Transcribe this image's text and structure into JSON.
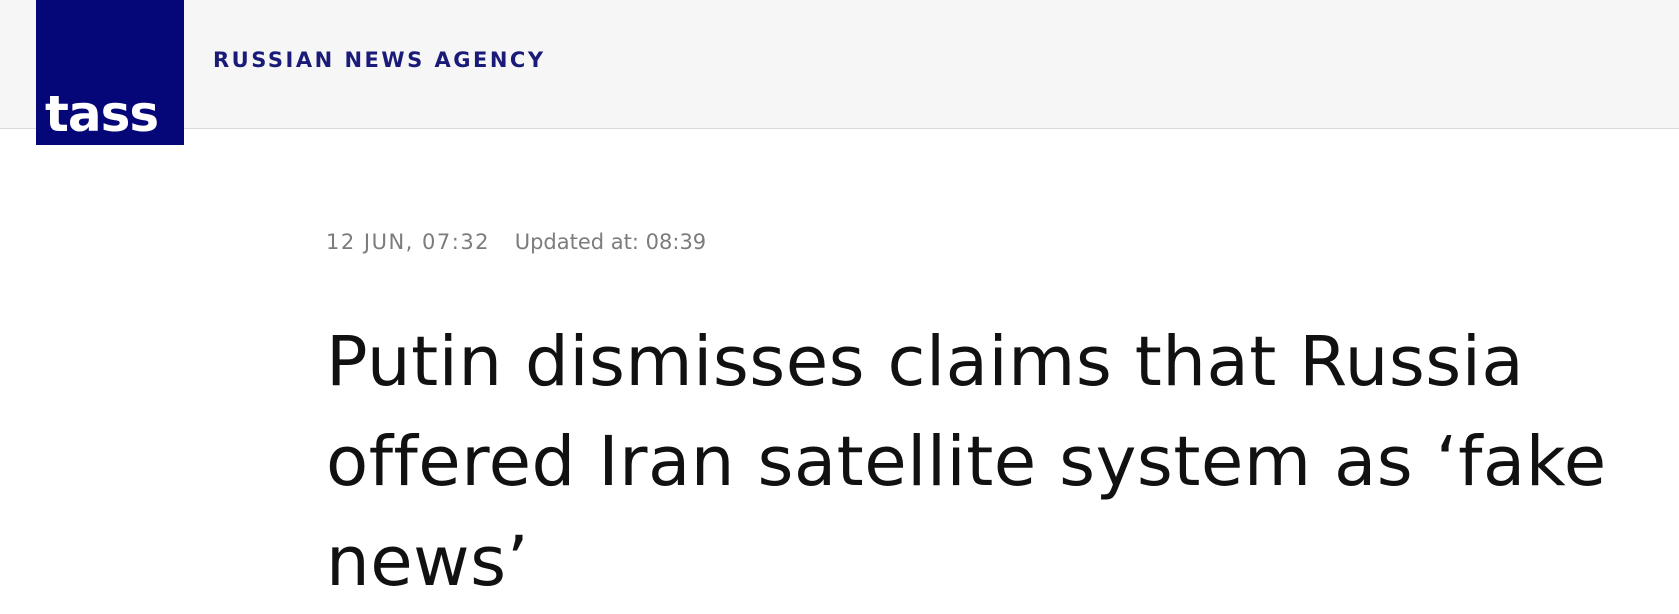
{
  "header": {
    "logo_text": "TASS",
    "agency_name": "RUSSIAN NEWS AGENCY"
  },
  "article": {
    "date": "12 JUN, 07:32",
    "updated": "Updated at: 08:39",
    "headline": "Putin dismisses claims that Russia offered Iran satellite system as ‘fake news’"
  },
  "colors": {
    "brand": "#050678",
    "header_bg": "#f6f6f6",
    "meta_text": "#7c7c7c",
    "headline_text": "#111111"
  }
}
